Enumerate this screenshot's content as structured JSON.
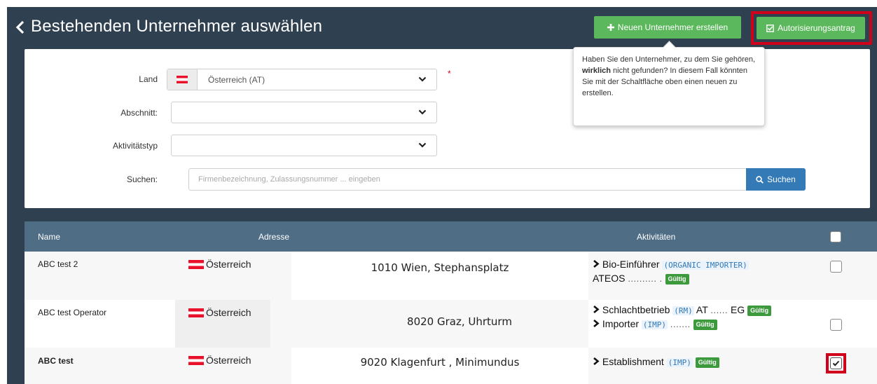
{
  "header": {
    "title": "Bestehenden Unternehmer auswählen",
    "btn_new": "Neuen Unternehmer erstellen",
    "btn_auth": "Autorisierungsantrag"
  },
  "tooltip": {
    "before": "Haben Sie den Unternehmer, zu dem Sie gehören, ",
    "bold": "wirklich",
    "after": " nicht gefunden? In diesem Fall könnten Sie mit der Schaltfläche oben einen neuen zu erstellen."
  },
  "form": {
    "land_label": "Land",
    "land_value": "Österreich (AT)",
    "required_mark": "*",
    "abschnitt_label": "Abschnitt:",
    "aktivitaet_label": "Aktivitätstyp",
    "search_label": "Suchen:",
    "search_placeholder": "Firmenbezeichnung, Zulassungsnummer ... eingeben",
    "search_button": "Suchen"
  },
  "table": {
    "headers": {
      "name": "Name",
      "adresse": "Adresse",
      "aktivitaeten": "Aktivitäten"
    },
    "rows": [
      {
        "name": "ABC test 2",
        "land": "Österreich",
        "adresse": "1010 Wien, Stephansplatz",
        "act1_label": "Bio-Einführer",
        "act1_code": "(ORGANIC IMPORTER)",
        "act1_ref": "ATEOS",
        "act1_mask": ".......... .",
        "status": "Gültig",
        "checked": false
      },
      {
        "name": "ABC test Operator",
        "land": "Österreich",
        "adresse": "8020 Graz, Uhrturm",
        "act1_label": "Schlachtbetrieb",
        "act1_code": "(RM)",
        "act1_ref": "AT",
        "act1_mask": "......",
        "act1_suffix": "EG",
        "act2_label": "Importer",
        "act2_code": "(IMP)",
        "act2_mask": ".......",
        "status": "Gültig",
        "checked": false
      },
      {
        "name": "ABC test",
        "land": "Österreich",
        "adresse": "9020 Klagenfurt , Minimundus",
        "act1_label": "Establishment",
        "act1_code": "(IMP)",
        "status": "Gültig",
        "checked": true
      }
    ]
  },
  "colors": {
    "background": "#2f4050",
    "table_header": "#4f6d85",
    "green_button": "#5cb85c",
    "blue_button": "#337ab7",
    "badge": "#3c9a3c",
    "highlight": "#d0021b"
  }
}
